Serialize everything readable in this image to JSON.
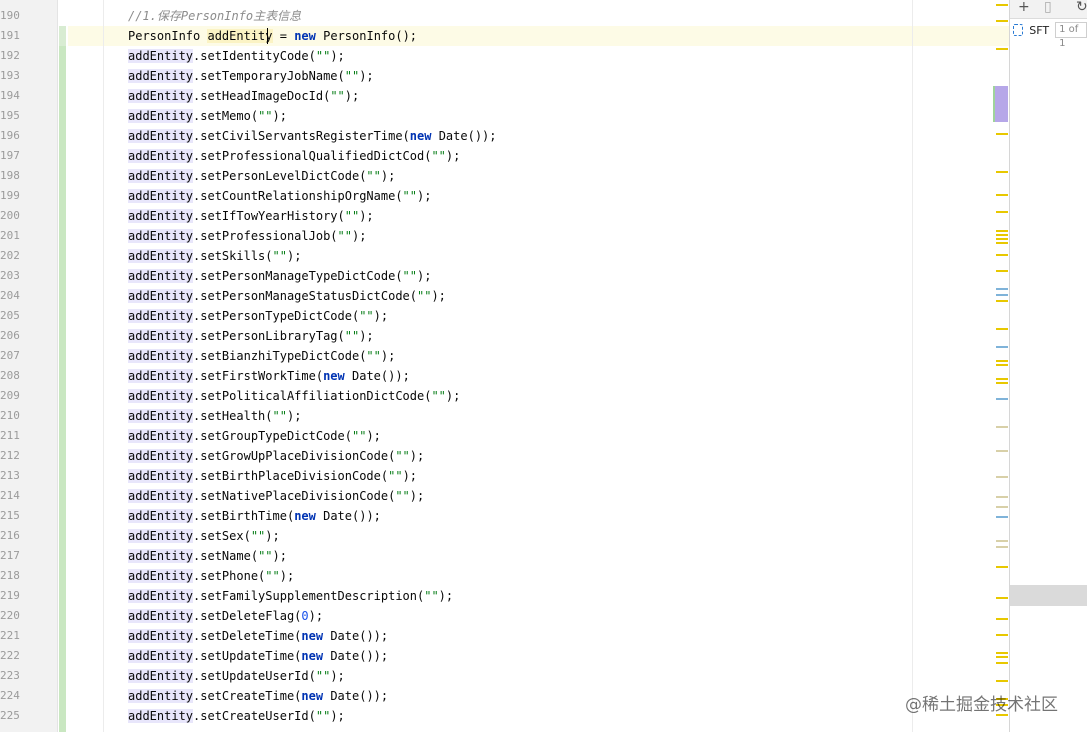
{
  "editor": {
    "line_numbers": [
      "190",
      "191",
      "192",
      "193",
      "194",
      "195",
      "196",
      "197",
      "198",
      "199",
      "200",
      "201",
      "202",
      "203",
      "204",
      "205",
      "206",
      "207",
      "208",
      "209",
      "210",
      "211",
      "212",
      "213",
      "214",
      "215",
      "216",
      "217",
      "218",
      "219",
      "220",
      "221",
      "222",
      "223",
      "224",
      "225"
    ],
    "comment": "//1.保存PersonInfo主表信息",
    "decl": {
      "type": "PersonInfo",
      "var": "addEntity",
      "eq": " = ",
      "kw_new": "new",
      "ctor": " PersonInfo();"
    },
    "var": "addEntity",
    "calls": [
      {
        "method": ".setIdentityCode(",
        "arg": "\"\"",
        "arg_type": "str",
        "end": ");"
      },
      {
        "method": ".setTemporaryJobName(",
        "arg": "\"\"",
        "arg_type": "str",
        "end": ");"
      },
      {
        "method": ".setHeadImageDocId(",
        "arg": "\"\"",
        "arg_type": "str",
        "end": ");"
      },
      {
        "method": ".setMemo(",
        "arg": "\"\"",
        "arg_type": "str",
        "end": ");"
      },
      {
        "method": ".setCivilServantsRegisterTime(",
        "arg": "new",
        "arg_type": "kw",
        "end": " Date());"
      },
      {
        "method": ".setProfessionalQualifiedDictCod(",
        "arg": "\"\"",
        "arg_type": "str",
        "end": ");"
      },
      {
        "method": ".setPersonLevelDictCode(",
        "arg": "\"\"",
        "arg_type": "str",
        "end": ");"
      },
      {
        "method": ".setCountRelationshipOrgName(",
        "arg": "\"\"",
        "arg_type": "str",
        "end": ");"
      },
      {
        "method": ".setIfTowYearHistory(",
        "arg": "\"\"",
        "arg_type": "str",
        "end": ");"
      },
      {
        "method": ".setProfessionalJob(",
        "arg": "\"\"",
        "arg_type": "str",
        "end": ");"
      },
      {
        "method": ".setSkills(",
        "arg": "\"\"",
        "arg_type": "str",
        "end": ");"
      },
      {
        "method": ".setPersonManageTypeDictCode(",
        "arg": "\"\"",
        "arg_type": "str",
        "end": ");"
      },
      {
        "method": ".setPersonManageStatusDictCode(",
        "arg": "\"\"",
        "arg_type": "str",
        "end": ");"
      },
      {
        "method": ".setPersonTypeDictCode(",
        "arg": "\"\"",
        "arg_type": "str",
        "end": ");"
      },
      {
        "method": ".setPersonLibraryTag(",
        "arg": "\"\"",
        "arg_type": "str",
        "end": ");"
      },
      {
        "method": ".setBianzhiTypeDictCode(",
        "arg": "\"\"",
        "arg_type": "str",
        "end": ");"
      },
      {
        "method": ".setFirstWorkTime(",
        "arg": "new",
        "arg_type": "kw",
        "end": " Date());"
      },
      {
        "method": ".setPoliticalAffiliationDictCode(",
        "arg": "\"\"",
        "arg_type": "str",
        "end": ");"
      },
      {
        "method": ".setHealth(",
        "arg": "\"\"",
        "arg_type": "str",
        "end": ");"
      },
      {
        "method": ".setGroupTypeDictCode(",
        "arg": "\"\"",
        "arg_type": "str",
        "end": ");"
      },
      {
        "method": ".setGrowUpPlaceDivisionCode(",
        "arg": "\"\"",
        "arg_type": "str",
        "end": ");"
      },
      {
        "method": ".setBirthPlaceDivisionCode(",
        "arg": "\"\"",
        "arg_type": "str",
        "end": ");"
      },
      {
        "method": ".setNativePlaceDivisionCode(",
        "arg": "\"\"",
        "arg_type": "str",
        "end": ");"
      },
      {
        "method": ".setBirthTime(",
        "arg": "new",
        "arg_type": "kw",
        "end": " Date());"
      },
      {
        "method": ".setSex(",
        "arg": "\"\"",
        "arg_type": "str",
        "end": ");"
      },
      {
        "method": ".setName(",
        "arg": "\"\"",
        "arg_type": "str",
        "end": ");"
      },
      {
        "method": ".setPhone(",
        "arg": "\"\"",
        "arg_type": "str",
        "end": ");"
      },
      {
        "method": ".setFamilySupplementDescription(",
        "arg": "\"\"",
        "arg_type": "str",
        "end": ");"
      },
      {
        "method": ".setDeleteFlag(",
        "arg": "0",
        "arg_type": "num",
        "end": ");"
      },
      {
        "method": ".setDeleteTime(",
        "arg": "new",
        "arg_type": "kw",
        "end": " Date());"
      },
      {
        "method": ".setUpdateTime(",
        "arg": "new",
        "arg_type": "kw",
        "end": " Date());"
      },
      {
        "method": ".setUpdateUserId(",
        "arg": "\"\"",
        "arg_type": "str",
        "end": ");"
      },
      {
        "method": ".setCreateTime(",
        "arg": "new",
        "arg_type": "kw",
        "end": " Date());"
      },
      {
        "method": ".setCreateUserId(",
        "arg": "\"\"",
        "arg_type": "str",
        "end": ");"
      }
    ]
  },
  "side_panel": {
    "toolbar_icons": [
      "add-icon",
      "copy-icon",
      "refresh-icon"
    ],
    "add_glyph": "+",
    "copy_glyph": "▯",
    "refresh_glyph": "↻",
    "item_label": "SFT",
    "item_count": "1 of 1"
  },
  "watermark": "@稀土掘金技术社区",
  "colors": {
    "keyword": "#0033b3",
    "string": "#067d17",
    "number": "#1750eb",
    "comment": "#8c8c8c",
    "usage_highlight": "#e8e6fb",
    "stripe_yellow": "#e8c800",
    "stripe_blue": "#7fb3d9",
    "stripe_tan": "#d8d0a8"
  }
}
